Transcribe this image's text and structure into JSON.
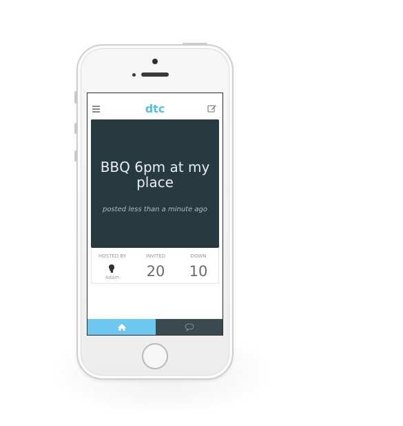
{
  "app": {
    "logo_text": "dtc",
    "accent_color": "#4fc0e8"
  },
  "navbar": {
    "menu_icon": "hamburger-menu-icon",
    "compose_icon": "compose-edit-icon"
  },
  "event": {
    "title": "BBQ 6pm at my place",
    "posted": "posted less than a minute ago",
    "background_color": "#263a40"
  },
  "stats": {
    "hosted_by_label": "HOSTED BY",
    "host_name": "Adam",
    "host_avatar_icon": "person-silhouette-icon",
    "invited_label": "INVITED",
    "invited_count": "20",
    "down_label": "DOWN",
    "down_count": "10"
  },
  "tabbar": {
    "home_icon": "home-icon",
    "chat_icon": "speech-bubble-icon",
    "active_tab": "home",
    "active_color": "#6cc8ef",
    "inactive_color": "#3a4a50"
  }
}
